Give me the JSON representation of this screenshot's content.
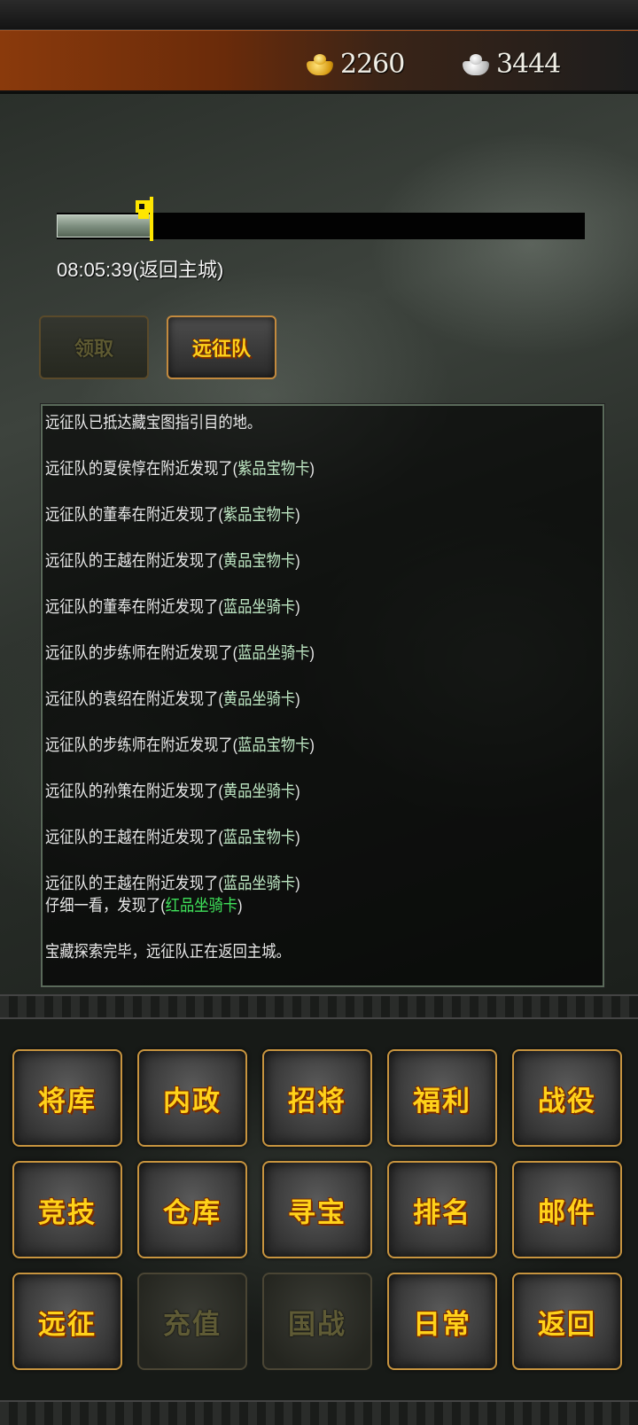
{
  "currency": {
    "gold_icon": "gold-ingot-icon",
    "gold_value": "2260",
    "silver_icon": "silver-ingot-icon",
    "silver_value": "3444"
  },
  "expedition": {
    "progress": 0.18,
    "timer": "08:05:39(返回主城)",
    "claim_label": "领取",
    "team_label": "远征队"
  },
  "log": [
    {
      "text": "远征队已抵达藏宝图指引目的地。",
      "item": ""
    },
    {
      "text": "远征队的夏侯惇在附近发现了(",
      "item": "紫品宝物卡",
      "tail": ")"
    },
    {
      "text": "远征队的董奉在附近发现了(",
      "item": "紫品宝物卡",
      "tail": ")"
    },
    {
      "text": "远征队的王越在附近发现了(",
      "item": "黄品宝物卡",
      "tail": ")"
    },
    {
      "text": "远征队的董奉在附近发现了(",
      "item": "蓝品坐骑卡",
      "tail": ")"
    },
    {
      "text": "远征队的步练师在附近发现了(",
      "item": "蓝品坐骑卡",
      "tail": ")"
    },
    {
      "text": "远征队的袁绍在附近发现了(",
      "item": "黄品坐骑卡",
      "tail": ")"
    },
    {
      "text": "远征队的步练师在附近发现了(",
      "item": "蓝品宝物卡",
      "tail": ")"
    },
    {
      "text": "远征队的孙策在附近发现了(",
      "item": "黄品坐骑卡",
      "tail": ")"
    },
    {
      "text": "远征队的王越在附近发现了(",
      "item": "蓝品宝物卡",
      "tail": ")"
    },
    {
      "text": "远征队的王越在附近发现了(",
      "item": "蓝品坐骑卡",
      "tail": ")"
    },
    {
      "text": "仔细一看，发现了(",
      "item": "红品坐骑卡",
      "tail": ")"
    },
    {
      "text": "宝藏探索完毕，远征队正在返回主城。",
      "item": ""
    }
  ],
  "menu": [
    {
      "label": "将库",
      "enabled": true
    },
    {
      "label": "内政",
      "enabled": true
    },
    {
      "label": "招将",
      "enabled": true
    },
    {
      "label": "福利",
      "enabled": true
    },
    {
      "label": "战役",
      "enabled": true
    },
    {
      "label": "竞技",
      "enabled": true
    },
    {
      "label": "仓库",
      "enabled": true
    },
    {
      "label": "寻宝",
      "enabled": true
    },
    {
      "label": "排名",
      "enabled": true
    },
    {
      "label": "邮件",
      "enabled": true
    },
    {
      "label": "远征",
      "enabled": true
    },
    {
      "label": "充值",
      "enabled": false
    },
    {
      "label": "国战",
      "enabled": false
    },
    {
      "label": "日常",
      "enabled": true
    },
    {
      "label": "返回",
      "enabled": true
    }
  ]
}
